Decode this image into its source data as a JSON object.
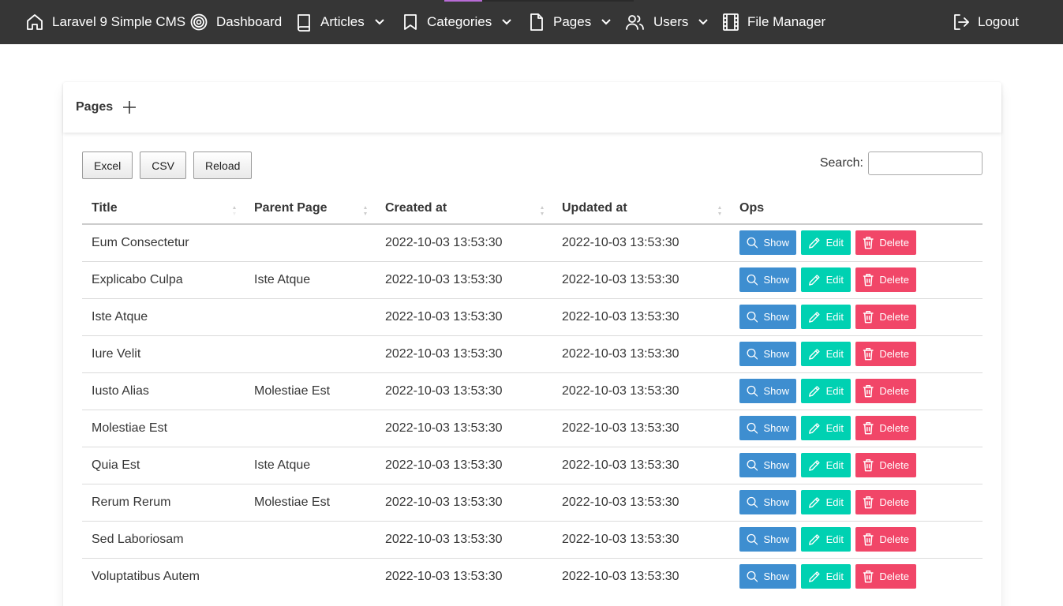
{
  "navbar": {
    "brand": "Laravel 9 Simple CMS",
    "dashboard": "Dashboard",
    "articles": "Articles",
    "categories": "Categories",
    "pages": "Pages",
    "users": "Users",
    "file_manager": "File Manager",
    "logout": "Logout"
  },
  "card": {
    "title": "Pages"
  },
  "toolbar": {
    "excel": "Excel",
    "csv": "CSV",
    "reload": "Reload",
    "search_label": "Search:",
    "search_value": ""
  },
  "table": {
    "headers": {
      "title": "Title",
      "parent": "Parent Page",
      "created": "Created at",
      "updated": "Updated at",
      "ops": "Ops"
    },
    "buttons": {
      "show": "Show",
      "edit": "Edit",
      "delete": "Delete"
    },
    "rows": [
      {
        "title": "Eum Consectetur",
        "parent": "",
        "created": "2022-10-03 13:53:30",
        "updated": "2022-10-03 13:53:30"
      },
      {
        "title": "Explicabo Culpa",
        "parent": "Iste Atque",
        "created": "2022-10-03 13:53:30",
        "updated": "2022-10-03 13:53:30"
      },
      {
        "title": "Iste Atque",
        "parent": "",
        "created": "2022-10-03 13:53:30",
        "updated": "2022-10-03 13:53:30"
      },
      {
        "title": "Iure Velit",
        "parent": "",
        "created": "2022-10-03 13:53:30",
        "updated": "2022-10-03 13:53:30"
      },
      {
        "title": "Iusto Alias",
        "parent": "Molestiae Est",
        "created": "2022-10-03 13:53:30",
        "updated": "2022-10-03 13:53:30"
      },
      {
        "title": "Molestiae Est",
        "parent": "",
        "created": "2022-10-03 13:53:30",
        "updated": "2022-10-03 13:53:30"
      },
      {
        "title": "Quia Est",
        "parent": "Iste Atque",
        "created": "2022-10-03 13:53:30",
        "updated": "2022-10-03 13:53:30"
      },
      {
        "title": "Rerum Rerum",
        "parent": "Molestiae Est",
        "created": "2022-10-03 13:53:30",
        "updated": "2022-10-03 13:53:30"
      },
      {
        "title": "Sed Laboriosam",
        "parent": "",
        "created": "2022-10-03 13:53:30",
        "updated": "2022-10-03 13:53:30"
      },
      {
        "title": "Voluptatibus Autem",
        "parent": "",
        "created": "2022-10-03 13:53:30",
        "updated": "2022-10-03 13:53:30"
      }
    ]
  },
  "colors": {
    "navbar_bg": "#363636",
    "show": "#3e8ed0",
    "edit": "#00d1b2",
    "delete": "#f14668"
  },
  "icons": {
    "brand": "home-icon",
    "dashboard": "target-icon",
    "articles": "book-icon",
    "categories": "bookmark-icon",
    "pages": "file-icon",
    "users": "users-icon",
    "file_manager": "film-icon",
    "logout": "logout-icon",
    "add": "plus-icon",
    "show": "search-icon",
    "edit": "pencil-icon",
    "delete": "trash-icon"
  }
}
